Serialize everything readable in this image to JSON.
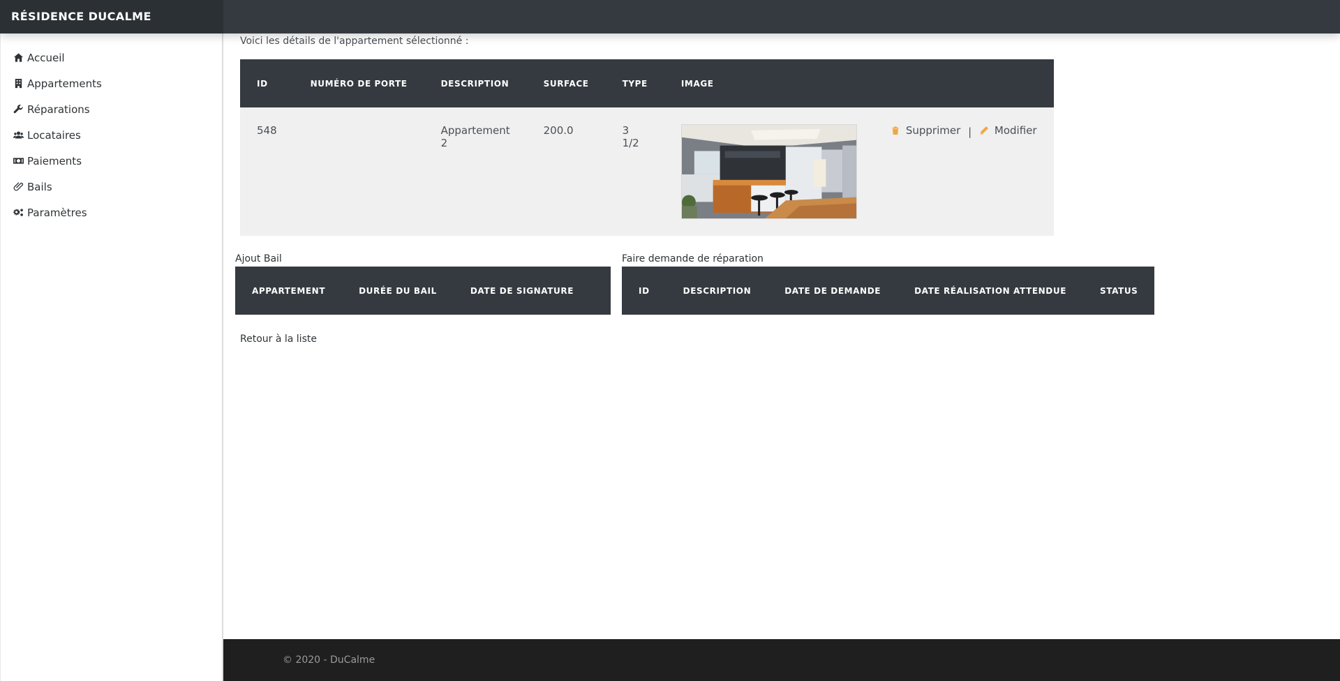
{
  "brand": {
    "title": "RÉSIDENCE DUCALME"
  },
  "sidebar": {
    "items": [
      {
        "label": "Accueil",
        "icon": "home-icon"
      },
      {
        "label": "Appartements",
        "icon": "building-icon"
      },
      {
        "label": "Réparations",
        "icon": "wrench-icon"
      },
      {
        "label": "Locataires",
        "icon": "users-icon"
      },
      {
        "label": "Paiements",
        "icon": "money-icon"
      },
      {
        "label": "Bails",
        "icon": "paperclip-icon"
      },
      {
        "label": "Paramètres",
        "icon": "gears-icon"
      }
    ]
  },
  "main": {
    "intro": "Voici les détails de l'appartement sélectionné :",
    "detail_table": {
      "headers": [
        "ID",
        "NUMÉRO DE PORTE",
        "DESCRIPTION",
        "SURFACE",
        "TYPE",
        "IMAGE"
      ],
      "row": {
        "id": "548",
        "door_number": "",
        "description": "Appartement 2",
        "surface": "200.0",
        "type": "3 1/2",
        "image": "kitchen-photo"
      },
      "actions": {
        "delete_label": "Supprimer",
        "separator": "|",
        "edit_label": "Modifier",
        "accent_color": "#f0a742"
      }
    },
    "bail": {
      "label": "Ajout Bail",
      "headers": [
        "APPARTEMENT",
        "DURÉE DU BAIL",
        "DATE DE SIGNATURE"
      ]
    },
    "repair": {
      "label": "Faire demande de réparation",
      "headers": [
        "ID",
        "DESCRIPTION",
        "DATE DE DEMANDE",
        "DATE RÉALISATION ATTENDUE",
        "STATUS"
      ]
    },
    "back_link": "Retour à la liste"
  },
  "footer": {
    "text": "© 2020 - DuCalme"
  },
  "colors": {
    "header_bg": "#343a40",
    "footer_bg": "#1f1f1f",
    "row_bg": "#f0f0f0"
  }
}
